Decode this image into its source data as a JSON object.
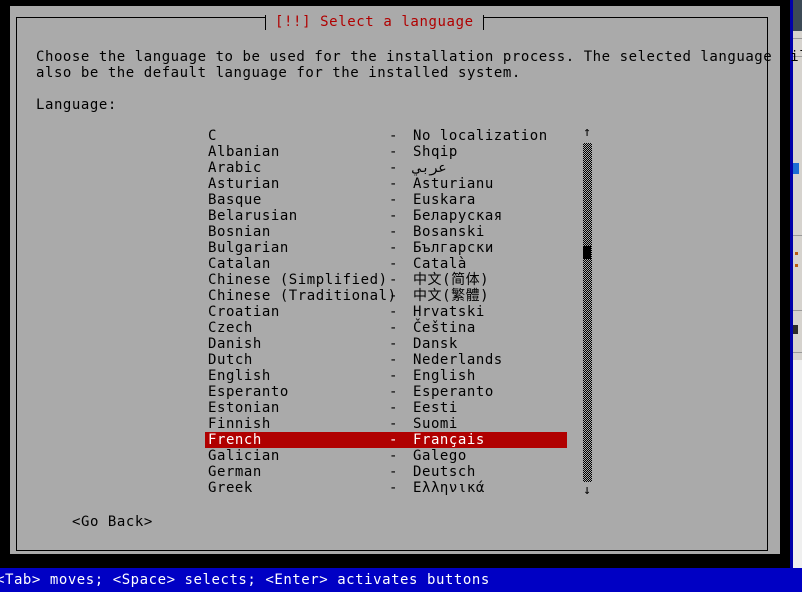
{
  "window": {
    "title": "[!!] Select a language",
    "title_color": "#b00000",
    "background_color": "#aaaaaa"
  },
  "description": {
    "line_1": "Choose the language to be used for the installation process. The selected language will",
    "line_2": "also be the default language for the installed system."
  },
  "form": {
    "language_label": "Language:"
  },
  "language_list": {
    "separator": "-",
    "selected_index": 19,
    "selected_highlight_color": "#b00000",
    "items": [
      {
        "name": "C",
        "native": "No localization"
      },
      {
        "name": "Albanian",
        "native": "Shqip"
      },
      {
        "name": "Arabic",
        "native": "عربي"
      },
      {
        "name": "Asturian",
        "native": "Asturianu"
      },
      {
        "name": "Basque",
        "native": "Euskara"
      },
      {
        "name": "Belarusian",
        "native": "Беларуская"
      },
      {
        "name": "Bosnian",
        "native": "Bosanski"
      },
      {
        "name": "Bulgarian",
        "native": "Български"
      },
      {
        "name": "Catalan",
        "native": "Català"
      },
      {
        "name": "Chinese (Simplified)",
        "native": "中文(简体)"
      },
      {
        "name": "Chinese (Traditional)",
        "native": "中文(繁體)"
      },
      {
        "name": "Croatian",
        "native": "Hrvatski"
      },
      {
        "name": "Czech",
        "native": "Čeština"
      },
      {
        "name": "Danish",
        "native": "Dansk"
      },
      {
        "name": "Dutch",
        "native": "Nederlands"
      },
      {
        "name": "English",
        "native": "English"
      },
      {
        "name": "Esperanto",
        "native": "Esperanto"
      },
      {
        "name": "Estonian",
        "native": "Eesti"
      },
      {
        "name": "Finnish",
        "native": "Suomi"
      },
      {
        "name": "French",
        "native": "Français"
      },
      {
        "name": "Galician",
        "native": "Galego"
      },
      {
        "name": "German",
        "native": "Deutsch"
      },
      {
        "name": "Greek",
        "native": "Ελληνικά"
      }
    ]
  },
  "scrollbar": {
    "up_arrow": "↑",
    "down_arrow": "↓"
  },
  "buttons": {
    "go_back": "<Go Back>"
  },
  "status_bar": {
    "text": "<Tab> moves; <Space> selects; <Enter> activates buttons",
    "background_color": "#0000c4",
    "text_color": "#ffffff"
  }
}
